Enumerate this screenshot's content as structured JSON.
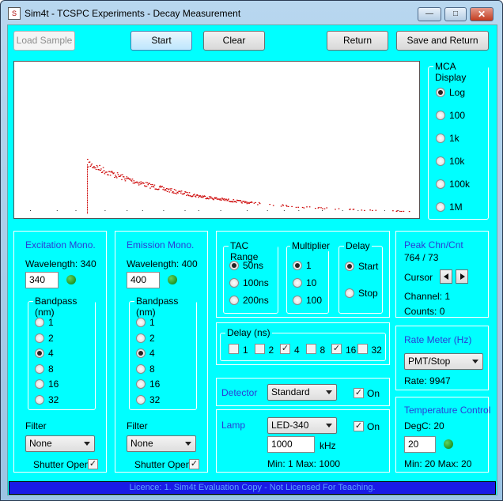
{
  "window": {
    "title": "Sim4t - TCSPC Experiments - Decay Measurement"
  },
  "toolbar": {
    "load_sample": "Load Sample",
    "start": "Start",
    "clear": "Clear",
    "return": "Return",
    "save_return": "Save and Return"
  },
  "mca": {
    "title": "MCA Display",
    "options": [
      "Log",
      "100",
      "1k",
      "10k",
      "100k",
      "1M"
    ],
    "selected": "Log"
  },
  "excitation": {
    "title": "Excitation Mono.",
    "wavelength_label": "Wavelength: 340",
    "wavelength_value": "340",
    "bandpass_title": "Bandpass (nm)",
    "bandpass_options": [
      "1",
      "2",
      "4",
      "8",
      "16",
      "32"
    ],
    "bandpass_selected": "4",
    "filter_label": "Filter",
    "filter_value": "None",
    "shutter_label": "Shutter Open"
  },
  "emission": {
    "title": "Emission Mono.",
    "wavelength_label": "Wavelength: 400",
    "wavelength_value": "400",
    "bandpass_title": "Bandpass (nm)",
    "bandpass_options": [
      "1",
      "2",
      "4",
      "8",
      "16",
      "32"
    ],
    "bandpass_selected": "4",
    "filter_label": "Filter",
    "filter_value": "None",
    "shutter_label": "Shutter Open"
  },
  "tac": {
    "title": "TAC Range",
    "options": [
      "50ns",
      "100ns",
      "200ns"
    ],
    "selected": "50ns"
  },
  "multiplier": {
    "title": "Multiplier",
    "options": [
      "1",
      "10",
      "100"
    ],
    "selected": "1"
  },
  "delay": {
    "title": "Delay",
    "options": [
      "Start",
      "Stop"
    ],
    "selected": "Start"
  },
  "delay_ns": {
    "title": "Delay (ns)",
    "items": [
      {
        "label": "1",
        "checked": false
      },
      {
        "label": "2",
        "checked": false
      },
      {
        "label": "4",
        "checked": true
      },
      {
        "label": "8",
        "checked": false
      },
      {
        "label": "16",
        "checked": true
      },
      {
        "label": "32",
        "checked": false
      }
    ]
  },
  "detector": {
    "label": "Detector",
    "value": "Standard",
    "on_label": "On"
  },
  "lamp": {
    "label": "Lamp",
    "value": "LED-340",
    "on_label": "On",
    "rate_value": "1000",
    "rate_unit": "kHz",
    "min_max": "Min: 1   Max: 1000"
  },
  "peak": {
    "title": "Peak Chn/Cnt",
    "value": "764 / 73",
    "cursor_label": "Cursor",
    "channel": "Channel:  1",
    "counts": "Counts:    0"
  },
  "rate_meter": {
    "title": "Rate Meter (Hz)",
    "select_value": "PMT/Stop",
    "rate": "Rate: 9947"
  },
  "temperature": {
    "title": "Temperature Control",
    "degc": "DegC: 20",
    "value": "20",
    "min_max": "Min: 20   Max: 20"
  },
  "status": {
    "text": "Licence: 1. Sim4t Evaluation Copy - Not Licensed For Teaching."
  },
  "chart_data": {
    "type": "scatter",
    "description_series": "decay histogram (log display)",
    "color": "#cc0000",
    "xlim": [
      0,
      1024
    ],
    "points_note": "sharp rise near channel ~180 followed by exponential decay"
  }
}
